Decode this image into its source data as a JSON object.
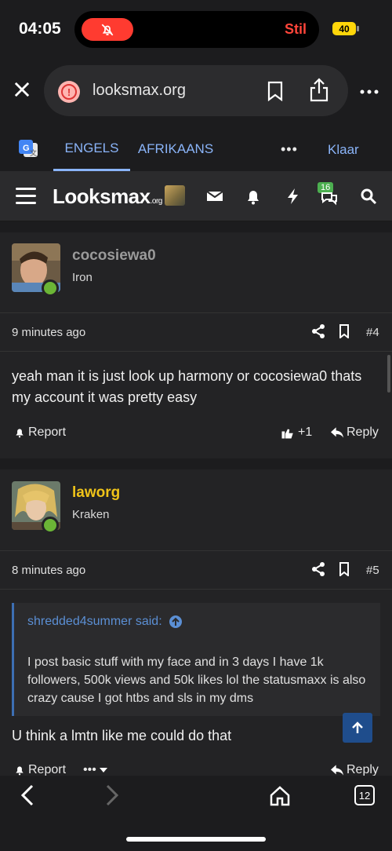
{
  "status": {
    "time": "04:05",
    "stil": "Stil",
    "battery": "40"
  },
  "url": {
    "text": "looksmax.org"
  },
  "translate": {
    "tab_english": "ENGELS",
    "tab_afrikaans": "AFRIKAANS",
    "done": "Klaar"
  },
  "site": {
    "logo_main": "Looksmax",
    "logo_suffix": ".org",
    "notif_badge": "16"
  },
  "posts": [
    {
      "username": "cocosiewa0",
      "rank": "Iron",
      "time": "9 minutes ago",
      "number": "#4",
      "body": "yeah man it is just look up harmony or cocosiewa0 thats my account it was pretty easy",
      "report": "Report",
      "reaction_count": "+1",
      "reply": "Reply"
    },
    {
      "username": "laworg",
      "rank": "Kraken",
      "time": "8 minutes ago",
      "number": "#5",
      "quote_author": "shredded4summer said:",
      "quote_text": "I post basic stuff with my face and in 3 days I have 1k followers, 500k views and 50k likes lol the statusmaxx is also crazy cause I got htbs and sls in my dms",
      "body": "U think a lmtn like me could do that",
      "report": "Report",
      "reply": "Reply"
    }
  ],
  "browser": {
    "tab_count": "12"
  },
  "colors": {
    "username_gold": "#f0c419",
    "username_gray": "#9a9a9a",
    "link_blue": "#8ab4f8"
  }
}
